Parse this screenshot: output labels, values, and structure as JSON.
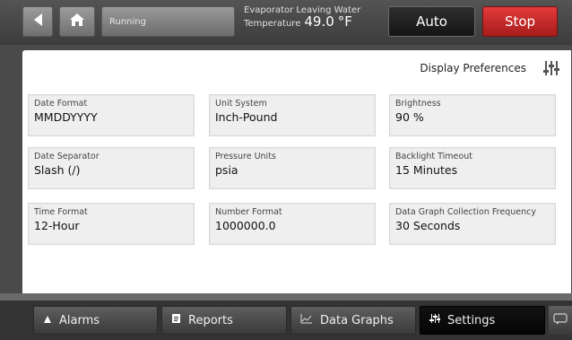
{
  "header": {
    "status": "Running",
    "evap_label_line1": "Evaporator Leaving Water",
    "evap_label_line2": "Temperature",
    "evap_value": "49.0",
    "evap_unit": "°F",
    "auto_label": "Auto",
    "stop_label": "Stop"
  },
  "page": {
    "title": "Display Preferences"
  },
  "settings": {
    "date_format": {
      "label": "Date Format",
      "value": "MMDDYYYY"
    },
    "unit_system": {
      "label": "Unit System",
      "value": "Inch-Pound"
    },
    "brightness": {
      "label": "Brightness",
      "value": "90 %"
    },
    "date_separator": {
      "label": "Date Separator",
      "value": "Slash (/)"
    },
    "pressure_units": {
      "label": "Pressure Units",
      "value": "psia"
    },
    "backlight_timeout": {
      "label": "Backlight Timeout",
      "value": "15 Minutes"
    },
    "time_format": {
      "label": "Time Format",
      "value": "12-Hour"
    },
    "number_format": {
      "label": "Number Format",
      "value": "1000000.0"
    },
    "graph_frequency": {
      "label": "Data Graph Collection Frequency",
      "value": "30 Seconds"
    }
  },
  "nav": {
    "alarms": "Alarms",
    "reports": "Reports",
    "data_graphs": "Data Graphs",
    "settings": "Settings"
  },
  "icons": {
    "back": "back-arrow-icon",
    "home": "home-icon",
    "preferences": "sliders-icon",
    "alarms": "bell-icon",
    "reports": "document-icon",
    "graphs": "line-chart-icon",
    "settings": "sliders-icon",
    "chat": "chat-bubble-icon"
  },
  "colors": {
    "stop": "#d42a2a",
    "auto": "#1b1b1b",
    "active_tab": "#0a0a0a",
    "panel": "#ffffff",
    "field": "#efefef"
  }
}
